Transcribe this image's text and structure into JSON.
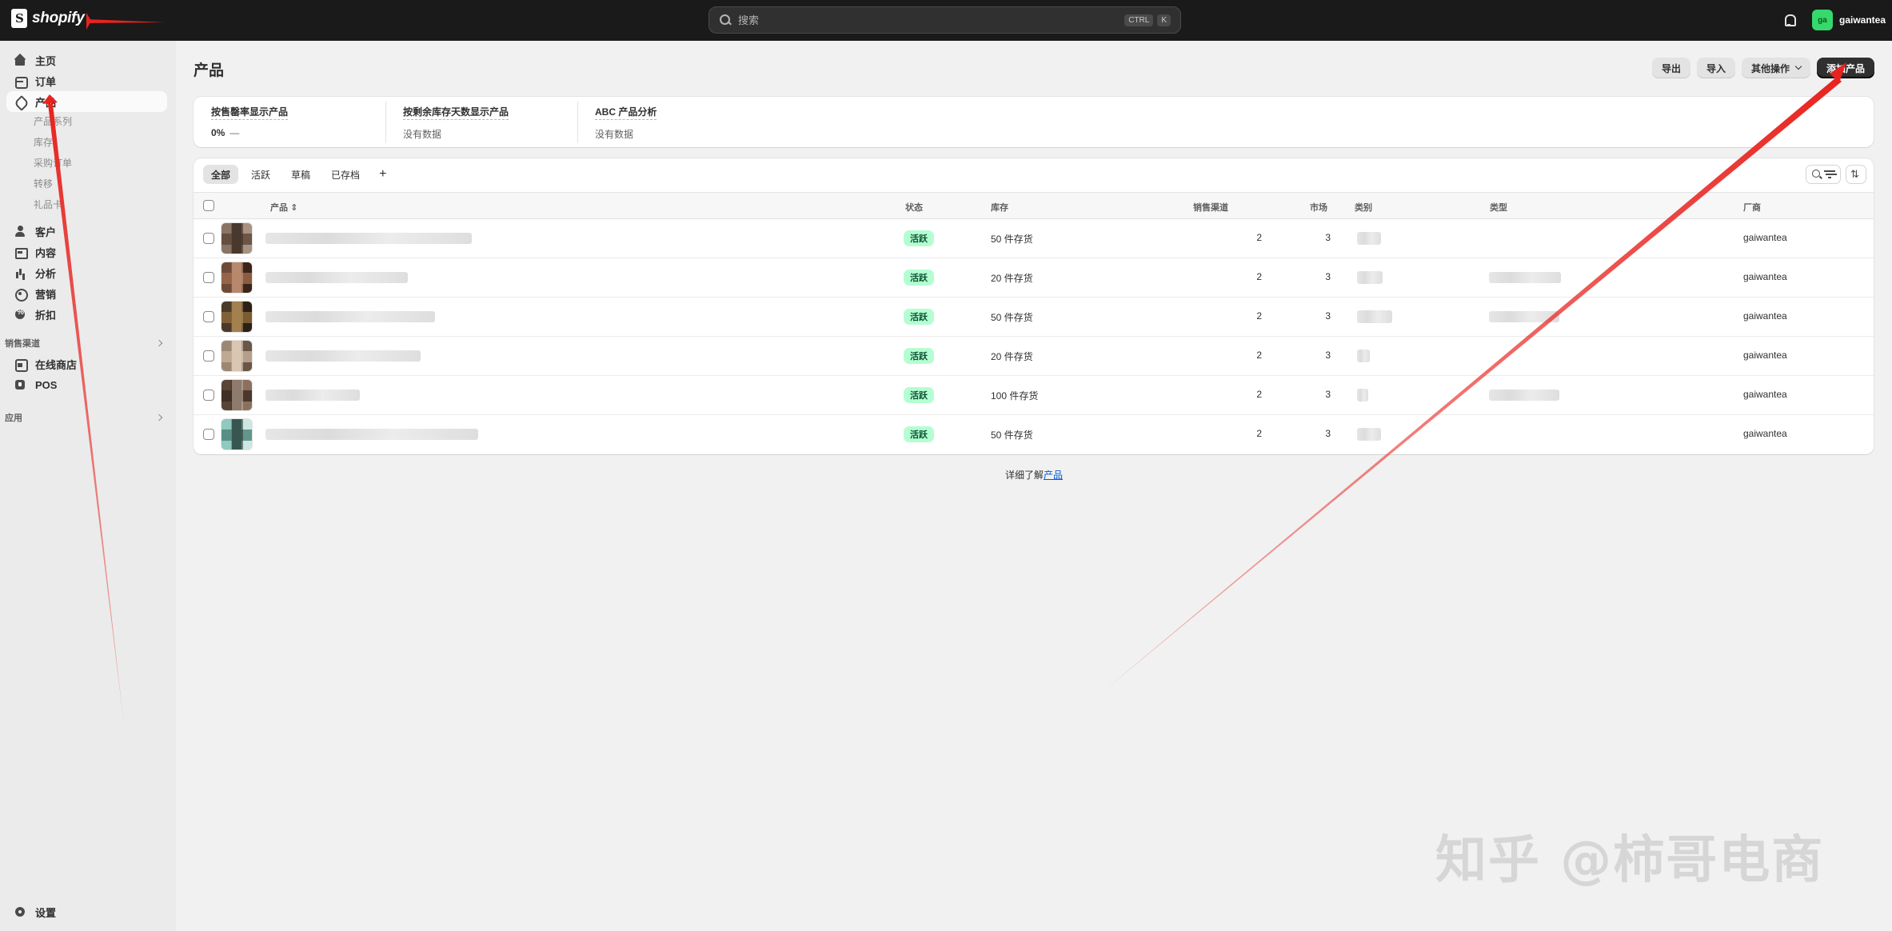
{
  "topbar": {
    "brand": "shopify",
    "search_placeholder": "搜索",
    "shortcut_keys": [
      "CTRL",
      "K"
    ],
    "avatar_initials": "ga",
    "store_name": "gaiwantea"
  },
  "sidebar": {
    "items": [
      {
        "label": "主页",
        "icon": "home-icon"
      },
      {
        "label": "订单",
        "icon": "inbox-icon"
      },
      {
        "label": "产品",
        "icon": "tag-icon"
      },
      {
        "label": "客户",
        "icon": "person-icon"
      },
      {
        "label": "内容",
        "icon": "content-icon"
      },
      {
        "label": "分析",
        "icon": "chart-icon"
      },
      {
        "label": "营销",
        "icon": "target-icon"
      },
      {
        "label": "折扣",
        "icon": "discount-icon"
      }
    ],
    "product_subitems": [
      "产品系列",
      "库存",
      "采购订单",
      "转移",
      "礼品卡"
    ],
    "sales_channels_label": "销售渠道",
    "channels": [
      {
        "label": "在线商店",
        "icon": "store-icon"
      },
      {
        "label": "POS",
        "icon": "pos-icon"
      }
    ],
    "apps_label": "应用",
    "settings_label": "设置"
  },
  "page": {
    "title": "产品",
    "actions": {
      "export": "导出",
      "import": "导入",
      "more": "其他操作",
      "add_product": "添加产品"
    }
  },
  "metrics": [
    {
      "title": "按售罄率显示产品",
      "value": "0%",
      "extra": "—"
    },
    {
      "title": "按剩余库存天数显示产品",
      "value": "没有数据",
      "extra": ""
    },
    {
      "title": "ABC 产品分析",
      "value": "没有数据",
      "extra": ""
    }
  ],
  "tabs": [
    "全部",
    "活跃",
    "草稿",
    "已存档"
  ],
  "table": {
    "headers": {
      "product": "产品",
      "status": "状态",
      "inventory": "库存",
      "sales_channels": "销售渠道",
      "markets": "市场",
      "category": "类别",
      "type": "类型",
      "vendor": "厂商"
    },
    "rows": [
      {
        "status": "活跃",
        "inventory": "50 件存货",
        "channels": "2",
        "markets": "3",
        "vendor": "gaiwantea"
      },
      {
        "status": "活跃",
        "inventory": "20 件存货",
        "channels": "2",
        "markets": "3",
        "vendor": "gaiwantea"
      },
      {
        "status": "活跃",
        "inventory": "50 件存货",
        "channels": "2",
        "markets": "3",
        "vendor": "gaiwantea"
      },
      {
        "status": "活跃",
        "inventory": "20 件存货",
        "channels": "2",
        "markets": "3",
        "vendor": "gaiwantea"
      },
      {
        "status": "活跃",
        "inventory": "100 件存货",
        "channels": "2",
        "markets": "3",
        "vendor": "gaiwantea"
      },
      {
        "status": "活跃",
        "inventory": "50 件存货",
        "channels": "2",
        "markets": "3",
        "vendor": "gaiwantea"
      }
    ]
  },
  "footer": {
    "prefix": "详细了解",
    "link": "产品"
  },
  "watermark": "知乎 @柿哥电商",
  "colors": {
    "annotation_arrow": "#e8231f",
    "status_badge_bg": "#b4fed2",
    "primary_button": "#303030"
  }
}
